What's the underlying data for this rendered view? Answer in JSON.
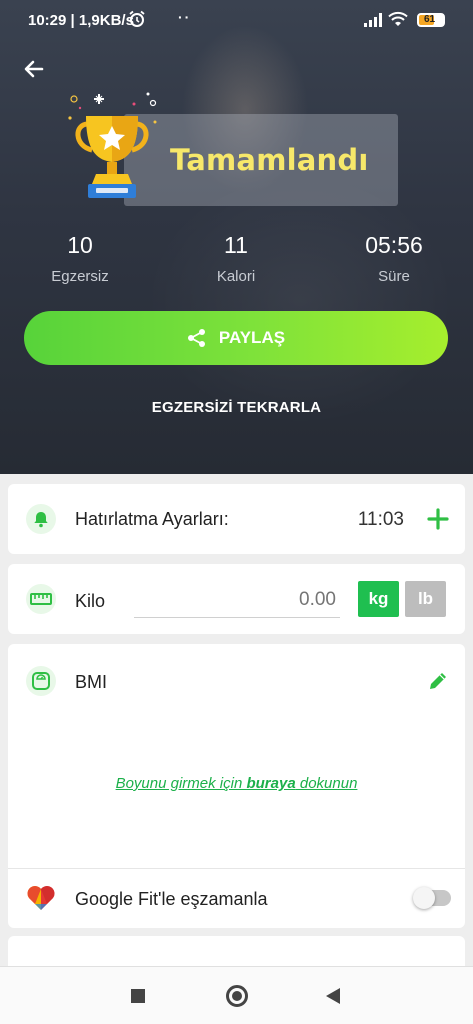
{
  "status_bar": {
    "time": "10:29 | 1,9KB/s",
    "dots": "··",
    "battery": "61",
    "battery_level": 0.61
  },
  "hero": {
    "title": "Tamamlandı",
    "stats": [
      {
        "value": "10",
        "label": "Egzersiz"
      },
      {
        "value": "11",
        "label": "Kalori"
      },
      {
        "value": "05:56",
        "label": "Süre"
      }
    ],
    "share_label": "PAYLAŞ",
    "repeat_label": "EGZERSİZİ TEKRARLA"
  },
  "reminder": {
    "label": "Hatırlatma Ayarları:",
    "time": "11:03"
  },
  "weight": {
    "label": "Kilo",
    "placeholder": "0.00",
    "unit_kg": "kg",
    "unit_lb": "lb",
    "selected_unit": "kg"
  },
  "bmi": {
    "label": "BMI",
    "hint_before": "Boyunu girmek için ",
    "hint_link": "buraya",
    "hint_after": " dokunun"
  },
  "google_fit": {
    "label": "Google Fit'le eşzamanla",
    "enabled": false
  },
  "colors": {
    "accent_green": "#1fbf50",
    "title_yellow": "#f7e86a",
    "share_gradient_start": "#57d33a",
    "share_gradient_end": "#a6ee2d"
  }
}
